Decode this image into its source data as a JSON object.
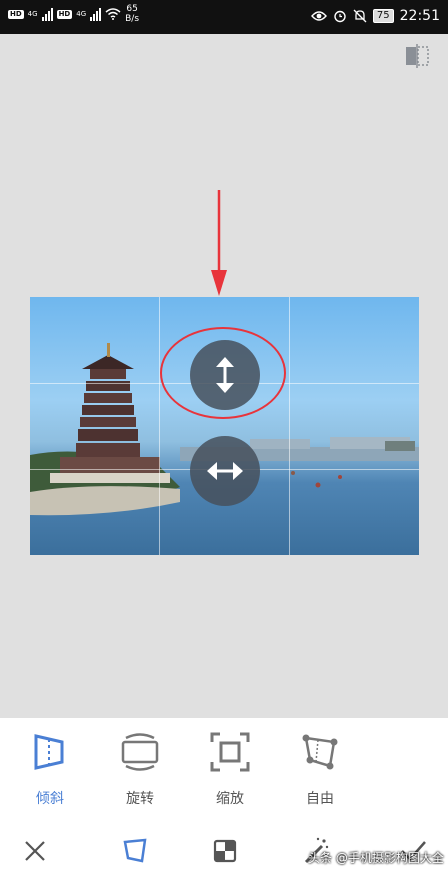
{
  "status_bar": {
    "left_labels": [
      "HD",
      "4G",
      "HD",
      "4G"
    ],
    "speed_value": "65",
    "speed_unit": "B/s",
    "battery": "75",
    "time": "22:51"
  },
  "tools": [
    {
      "label": "倾斜",
      "icon": "perspective-tilt-icon",
      "active": true
    },
    {
      "label": "旋转",
      "icon": "rotate-icon",
      "active": false
    },
    {
      "label": "缩放",
      "icon": "scale-icon",
      "active": false
    },
    {
      "label": "自由",
      "icon": "free-transform-icon",
      "active": false
    }
  ],
  "watermark": "头条 @手机摄影构图大全",
  "colors": {
    "accent": "#4a7fd4",
    "annotation_red": "#e8343b",
    "handle": "#46505c"
  }
}
